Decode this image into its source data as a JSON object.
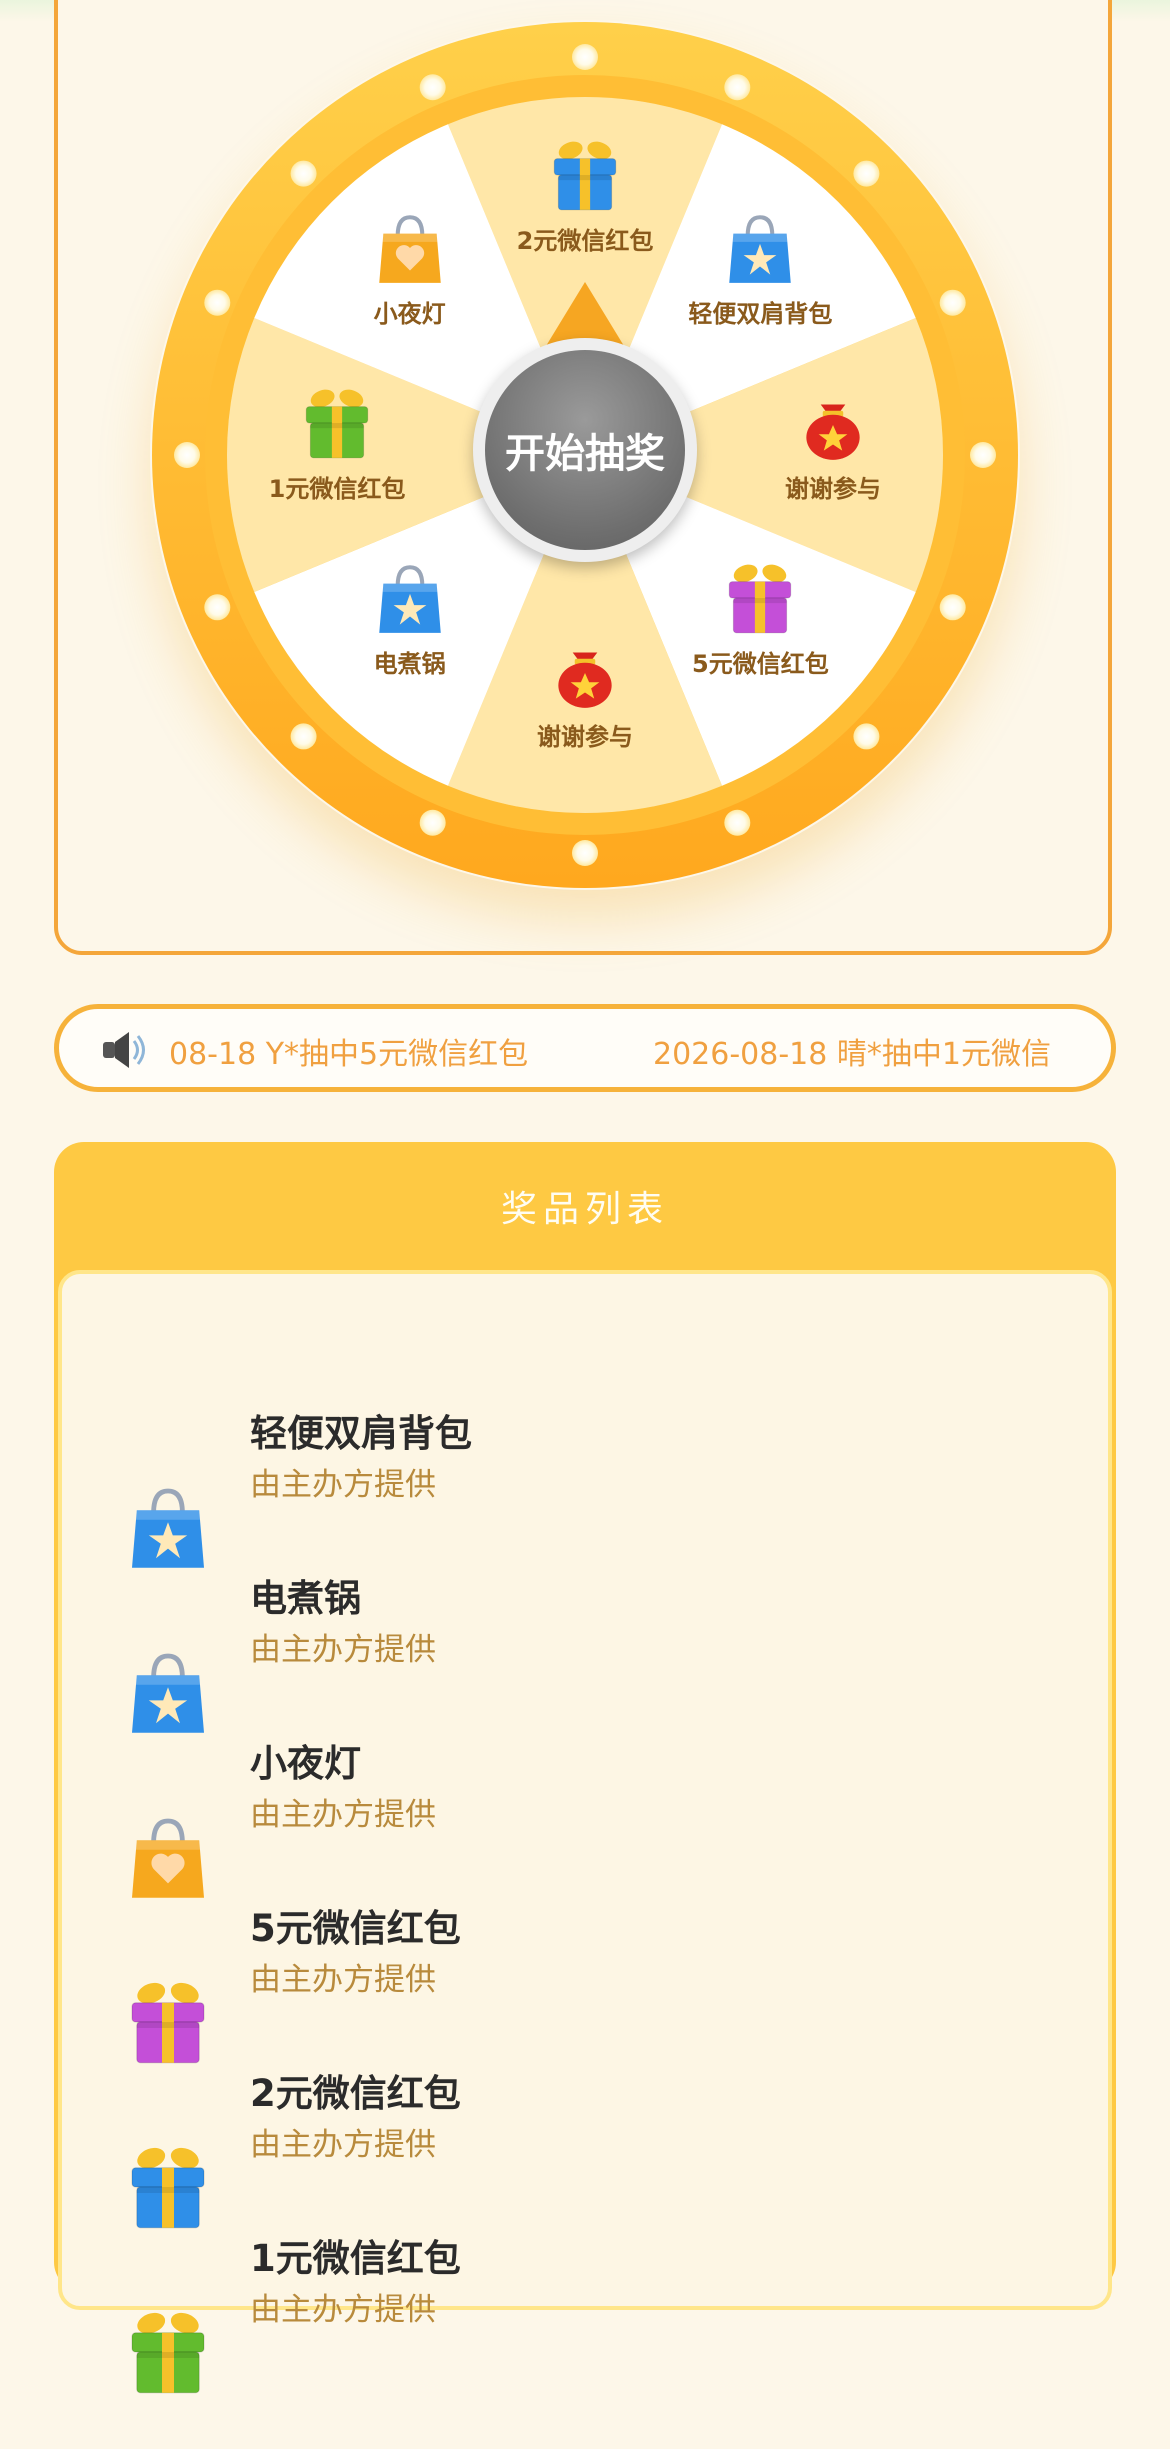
{
  "wheel": {
    "start_button": "开始抽奖",
    "segments": [
      {
        "label": "2元微信红包",
        "icon": "gift-box-blue-icon"
      },
      {
        "label": "轻便双肩背包",
        "icon": "shopping-bag-blue-icon"
      },
      {
        "label": "谢谢参与",
        "icon": "red-lucky-bag-icon"
      },
      {
        "label": "5元微信红包",
        "icon": "gift-box-purple-icon"
      },
      {
        "label": "谢谢参与",
        "icon": "red-lucky-bag-icon"
      },
      {
        "label": "电煮锅",
        "icon": "shopping-bag-blue-icon"
      },
      {
        "label": "1元微信红包",
        "icon": "gift-box-green-icon"
      },
      {
        "label": "小夜灯",
        "icon": "shopping-bag-orange-icon"
      }
    ],
    "colors": {
      "rim": "#ffb32a",
      "light_segment": "#ffe7a8",
      "white_segment": "#ffffff",
      "bulb": "#ffffff"
    }
  },
  "marquee": {
    "speaker_icon": "speaker-icon",
    "messages": [
      "08-18 Y*抽中5元微信红包",
      "2026-08-18 晴*抽中1元微信"
    ]
  },
  "prize_list": {
    "title": "奖品列表",
    "items": [
      {
        "name": "轻便双肩背包",
        "provider": "由主办方提供",
        "icon": "shopping-bag-blue-icon"
      },
      {
        "name": "电煮锅",
        "provider": "由主办方提供",
        "icon": "shopping-bag-blue-icon"
      },
      {
        "name": "小夜灯",
        "provider": "由主办方提供",
        "icon": "shopping-bag-orange-icon"
      },
      {
        "name": "5元微信红包",
        "provider": "由主办方提供",
        "icon": "gift-box-purple-icon"
      },
      {
        "name": "2元微信红包",
        "provider": "由主办方提供",
        "icon": "gift-box-blue-icon"
      },
      {
        "name": "1元微信红包",
        "provider": "由主办方提供",
        "icon": "gift-box-green-icon"
      }
    ]
  }
}
